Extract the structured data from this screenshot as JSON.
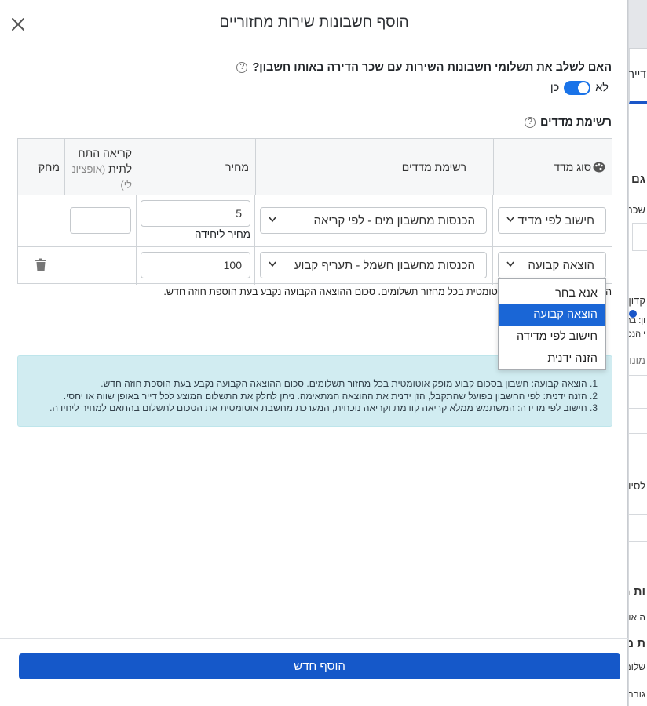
{
  "modal": {
    "title": "הוסף חשבונות שירות מחזוריים",
    "question": "האם לשלב את תשלומי חשבונות השירות עם שכר הדירה באותו חשבון?",
    "toggle": {
      "yes_label": "כן",
      "no_label": "לא",
      "value": "כן"
    },
    "meters_title": "רשימת מדדים",
    "add_button_label": "הוסף חדש",
    "hint_text": "קבוע מופק אוטומטית בכל מחזור תשלומים. סכום ההוצאה הקבועה נקבע בעת הוספת חוזה חדש.",
    "hint_edge": "ה"
  },
  "table": {
    "headers": {
      "meter_type": "סוג מדד",
      "meter_list": "רשימת מדדים",
      "price": "מחיר",
      "opening_reading_line1": "קריאה התח",
      "opening_reading_line2": "לתית",
      "opening_reading_optional": "(אופציונ",
      "opening_reading_line3": "לי)",
      "delete": "מחק"
    },
    "rows": [
      {
        "type": "חישוב לפי מדיד",
        "meter": "הכנסות מחשבון מים - לפי קריאה",
        "price": "5",
        "price_note": "מחיר ליחידה",
        "reading": ""
      },
      {
        "type": "הוצאה קבועה",
        "meter": "הכנסות מחשבון חשמל - תעריף קבוע",
        "price": "100",
        "price_note": "",
        "reading": ""
      }
    ]
  },
  "dropdown": {
    "options": [
      "אנא בחר",
      "הוצאה קבועה",
      "חישוב לפי מדידה",
      "הזנה ידנית"
    ],
    "selected": "הוצאה קבועה"
  },
  "info": {
    "lines": [
      "1. הוצאה קבועה: חשבון בסכום קבוע מופק אוטומטית בכל מחזור תשלומים. סכום ההוצאה הקבועה נקבע בעת הוספת חוזה חדש.",
      "2. הזנה ידנית: לפי החשבון בפועל שהתקבל, הזן ידנית את ההוצאה המתאימה. ניתן לחלק את התשלום המוצע לכל דייר באופן שווה או יחסי.",
      "3. חישוב לפי מדידה: המשתמש ממלא קריאה קודמת וקריאה נוכחית, המערכת מחשבת אוטומטית את הסכום לתשלום בהתאם למחיר ליחידה."
    ]
  },
  "background": {
    "tab": "דייר",
    "frag1": "גם",
    "frag2": "שכר",
    "frag3": "קדון",
    "frag4": "ון: בח",
    "frag5": "י הנכ",
    "frag6": "מונות",
    "frag7": "לסיו",
    "frag8": "ות מ",
    "frag9": "ה אוט",
    "frag10": "ת מ",
    "frag11": "שלומ",
    "frag12": "גובה"
  },
  "colors": {
    "primary": "#1558c9",
    "toggle": "#1a73e8",
    "info_bg": "#d1ecf1",
    "dropdown_active": "#1a66d6"
  }
}
